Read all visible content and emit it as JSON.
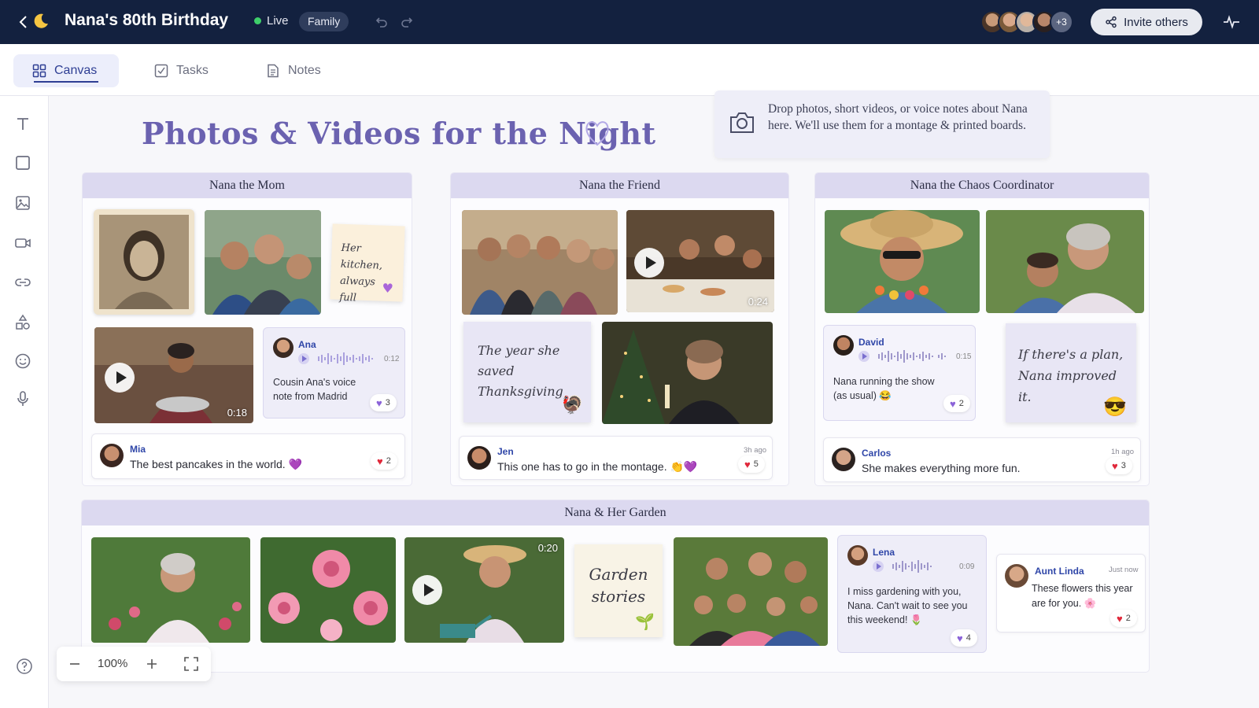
{
  "header": {
    "title": "Nana's 80th Birthday",
    "live_label": "Live",
    "badge": "Family",
    "avatars_more": "+3",
    "invite_label": "Invite others"
  },
  "tabs": [
    {
      "label": "Canvas",
      "icon": "grid-icon",
      "active": true
    },
    {
      "label": "Tasks",
      "icon": "checkbox-icon"
    },
    {
      "label": "Notes",
      "icon": "document-icon"
    }
  ],
  "tools": [
    "text-icon",
    "rectangle-icon",
    "image-icon",
    "video-icon",
    "link-icon",
    "shapes-icon",
    "emoji-icon",
    "microphone-icon"
  ],
  "canvas": {
    "heading": "Photos & Videos for the Night",
    "info_text": "Drop photos, short videos, or voice notes about Nana here. We'll use them for a montage & printed boards.",
    "zoom": "100%"
  },
  "sections": {
    "mom": {
      "title": "Nana the Mom",
      "sticky": "Her kitchen, always full",
      "video_duration": "0:18",
      "voice": {
        "name": "Ana",
        "time": "0:12",
        "text": "Cousin Ana's voice note from Madrid",
        "likes": "3"
      },
      "comment": {
        "name": "Mia",
        "text": "The best pancakes in the world. 💜",
        "likes": "2"
      }
    },
    "friend": {
      "title": "Nana the Friend",
      "video_duration": "0:24",
      "sticky": "The year she saved Thanksgiving",
      "comment": {
        "name": "Jen",
        "time": "3h ago",
        "text": "This one has to go in the montage. 👏💜",
        "likes": "5"
      }
    },
    "chaos": {
      "title": "Nana the Chaos Coordinator",
      "voice": {
        "name": "David",
        "time": "0:15",
        "text": "Nana running the show (as usual) 😂",
        "likes": "2"
      },
      "sticky": "If there's a plan, Nana improved it.",
      "comment": {
        "name": "Carlos",
        "time": "1h ago",
        "text": "She makes everything more fun.",
        "likes": "3"
      }
    },
    "garden": {
      "title": "Nana & Her Garden",
      "video_duration": "0:20",
      "sticky": "Garden stories",
      "voice": {
        "name": "Lena",
        "time": "0:09",
        "text": "I miss gardening with you, Nana. Can't wait to see you this weekend! 🌷",
        "likes": "4"
      },
      "comment": {
        "name": "Aunt Linda",
        "time": "Just now",
        "text": "These flowers this year are for you. 🌸",
        "likes": "2"
      }
    }
  },
  "colors": {
    "topbar": "#13213f",
    "accent": "#2f3f94",
    "section_header": "#dcd9f0",
    "heading": "#6b62b0"
  }
}
